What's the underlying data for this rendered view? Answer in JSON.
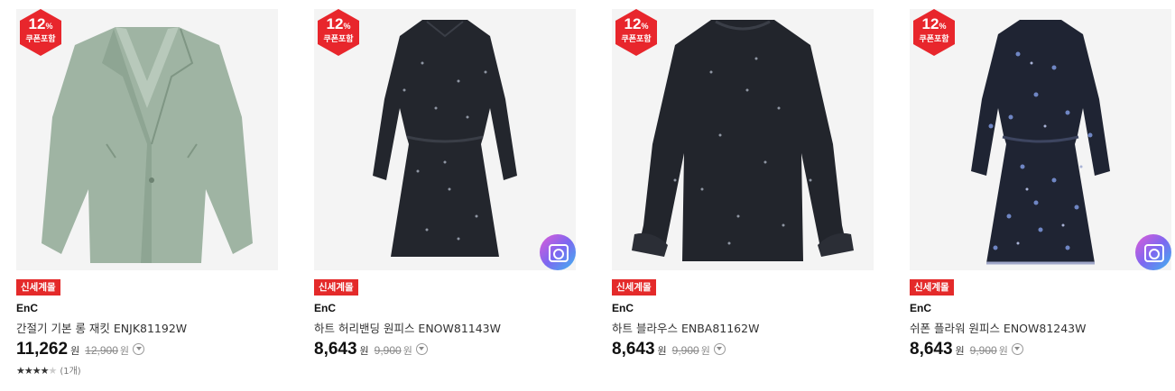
{
  "coupon": {
    "percent": "12",
    "percent_sign": "%",
    "label": "쿠폰포함"
  },
  "products": [
    {
      "badge": "신세계몰",
      "brand": "EnC",
      "name": "간절기 기본 롱 재킷 ENJK81192W",
      "price": "11,262",
      "won": "원",
      "original_price": "12,900",
      "original_won": "원",
      "rating_stars": "★★★★",
      "rating_empty": "★",
      "rating_value": 4,
      "review_count": "(1개)",
      "image": "coat",
      "color": "#9fb4a3",
      "has_camera": false
    },
    {
      "badge": "신세계몰",
      "brand": "EnC",
      "name": "하트 허리밴딩 원피스 ENOW81143W",
      "price": "8,643",
      "won": "원",
      "original_price": "9,900",
      "original_won": "원",
      "image": "dress",
      "color": "#23262d",
      "has_camera": true
    },
    {
      "badge": "신세계몰",
      "brand": "EnC",
      "name": "하트 블라우스 ENBA81162W",
      "price": "8,643",
      "won": "원",
      "original_price": "9,900",
      "original_won": "원",
      "image": "blouse",
      "color": "#22252c",
      "has_camera": false
    },
    {
      "badge": "신세계몰",
      "brand": "EnC",
      "name": "쉬폰 플라워 원피스 ENOW81243W",
      "price": "8,643",
      "won": "원",
      "original_price": "9,900",
      "original_won": "원",
      "image": "floral-dress",
      "color": "#1f2433",
      "has_camera": true
    }
  ],
  "colors": {
    "badge_bg": "#e42a2a",
    "coupon_bg": "#e8262c",
    "thumb_bg": "#f4f4f4"
  }
}
